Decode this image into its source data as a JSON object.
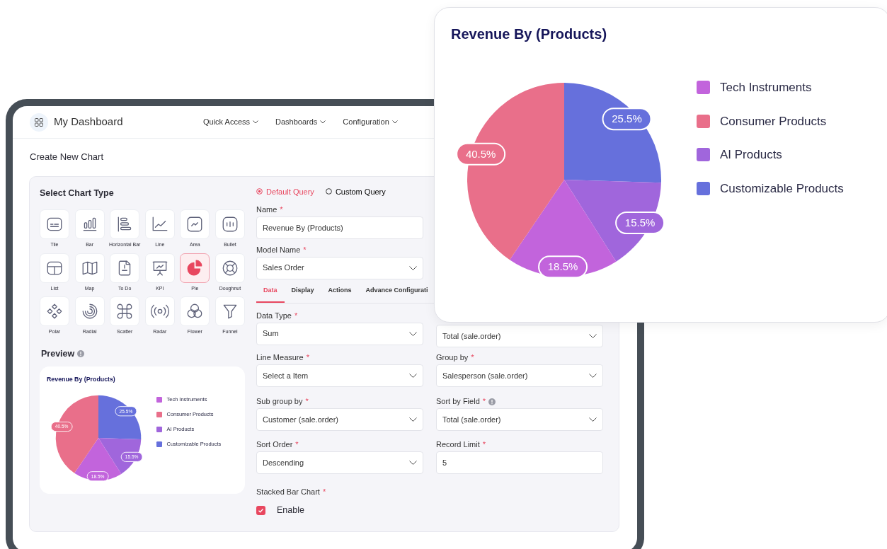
{
  "navbar": {
    "title": "My Dashboard",
    "menus": [
      {
        "label": "Quick Access"
      },
      {
        "label": "Dashboards"
      },
      {
        "label": "Configuration"
      }
    ]
  },
  "page_title": "Create New Chart",
  "chart_types": {
    "heading": "Select Chart Type",
    "items": [
      {
        "label": "Tile",
        "selected": false
      },
      {
        "label": "Bar",
        "selected": false
      },
      {
        "label": "Horizontal Bar",
        "selected": false
      },
      {
        "label": "Line",
        "selected": false
      },
      {
        "label": "Area",
        "selected": false
      },
      {
        "label": "Bullet",
        "selected": false
      },
      {
        "label": "List",
        "selected": false
      },
      {
        "label": "Map",
        "selected": false
      },
      {
        "label": "To Do",
        "selected": false
      },
      {
        "label": "KPI",
        "selected": false
      },
      {
        "label": "Pie",
        "selected": true
      },
      {
        "label": "Doughnut",
        "selected": false
      },
      {
        "label": "Polar",
        "selected": false
      },
      {
        "label": "Radial",
        "selected": false
      },
      {
        "label": "Scatter",
        "selected": false
      },
      {
        "label": "Radar",
        "selected": false
      },
      {
        "label": "Flower",
        "selected": false
      },
      {
        "label": "Funnel",
        "selected": false
      }
    ]
  },
  "preview": {
    "heading": "Preview",
    "chart_data": {
      "type": "pie",
      "title": "Revenue By (Products)",
      "values": [
        25.5,
        15.5,
        18.5,
        40.5
      ],
      "colors": [
        "#6670dc",
        "#a066dc",
        "#c264dc",
        "#e96f8a"
      ],
      "value_labels": [
        "25.5%",
        "15.5%",
        "18.5%",
        "40.5%"
      ]
    },
    "legend": [
      {
        "label": "Tech Instruments",
        "color": "#c264dc"
      },
      {
        "label": "Consumer Products",
        "color": "#e96f8a"
      },
      {
        "label": "AI Products",
        "color": "#a066dc"
      },
      {
        "label": "Customizable Products",
        "color": "#6670dc"
      }
    ]
  },
  "query_type": [
    {
      "label": "Default Query",
      "selected": true
    },
    {
      "label": "Custom Query",
      "selected": false
    }
  ],
  "top_fields": [
    {
      "kind": "text",
      "label": "Name",
      "required_mark": "*",
      "value": "Revenue By (Products)"
    },
    {
      "kind": "select",
      "label": "Model Name",
      "required_mark": "*",
      "value": "Sales Order"
    }
  ],
  "tabs": [
    {
      "label": "Data",
      "selected": true
    },
    {
      "label": "Display",
      "selected": false
    },
    {
      "label": "Actions",
      "selected": false
    },
    {
      "label": "Advance Configurati",
      "selected": false
    }
  ],
  "field_rows": [
    [
      {
        "kind": "select",
        "label": "Data Type",
        "required_mark": "*",
        "value": "Sum"
      },
      {
        "kind": "select",
        "value": "Total (sale.order)"
      }
    ],
    [
      {
        "kind": "select",
        "label": "Line Measure",
        "required_mark": "*",
        "value": "Select a Item"
      },
      {
        "kind": "select",
        "label": "Group by",
        "required_mark": "*",
        "value": "Salesperson (sale.order)"
      }
    ],
    [
      {
        "kind": "select",
        "label": "Sub group by",
        "required_mark": "*",
        "value": "Customer (sale.order)"
      },
      {
        "kind": "select",
        "label": "Sort by Field",
        "required_mark": "*",
        "info": true,
        "value": "Total  (sale.order)"
      }
    ],
    [
      {
        "kind": "select",
        "label": "Sort Order",
        "required_mark": "*",
        "value": "Descending"
      },
      {
        "kind": "text",
        "label": "Record Limit",
        "required_mark": "*",
        "value": "5"
      }
    ]
  ],
  "stacked": {
    "label": "Stacked Bar Chart",
    "required_mark": "*",
    "option": "Enable",
    "checked": true
  },
  "popout_card": {
    "chart_data": {
      "type": "pie",
      "title": "Revenue By (Products)",
      "values": [
        25.5,
        15.5,
        18.5,
        40.5
      ],
      "colors": [
        "#6670dc",
        "#a066dc",
        "#c264dc",
        "#e96f8a"
      ],
      "value_labels": [
        "25.5%",
        "15.5%",
        "18.5%",
        "40.5%"
      ]
    },
    "legend": [
      {
        "label": "Tech Instruments",
        "color": "#c264dc"
      },
      {
        "label": "Consumer Products",
        "color": "#e96f8a"
      },
      {
        "label": "AI Products",
        "color": "#a066dc"
      },
      {
        "label": "Customizable Products",
        "color": "#6670dc"
      }
    ]
  }
}
